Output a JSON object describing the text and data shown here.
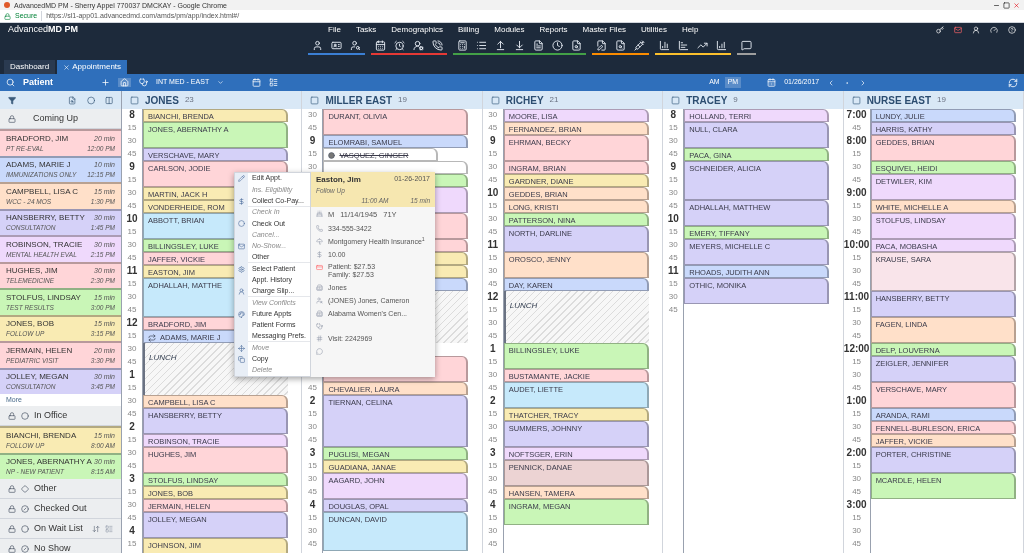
{
  "browser": {
    "title": "AdvancedMD PM - Sherry Appel 770037 DMCKAY - Google Chrome",
    "secure": "Secure",
    "url": "https://sl1-app01.advancedmd.com/amds/pm/app/index.html#/"
  },
  "app": {
    "logo": "Advanced**MD PM**",
    "menu": [
      "File",
      "Tasks",
      "Demographics",
      "Billing",
      "Modules",
      "Reports",
      "Master Files",
      "Utilities",
      "Help"
    ],
    "toolbar_groups": [
      {
        "color": "#3b7fd4"
      },
      {
        "color": "#e53935"
      },
      {
        "color": "#43a047"
      },
      {
        "color": "#fb8c00"
      },
      {
        "color": "#fbc02d"
      },
      {
        "color": "#9e9e9e"
      }
    ]
  },
  "tabs": [
    {
      "label": "Dashboard",
      "selected": false,
      "closable": false
    },
    {
      "label": "Appointments",
      "selected": true,
      "closable": true
    }
  ],
  "patient_bar": {
    "label": "Patient",
    "provider_group": "INT MED - EAST",
    "ampm": [
      {
        "label": "AM",
        "selected": false
      },
      {
        "label": "PM",
        "selected": true
      }
    ],
    "date": "01/26/2017"
  },
  "sidebar": {
    "sections": [
      {
        "title": "Coming Up",
        "more": "More",
        "items": [
          {
            "name": "BRADFORD, JIM",
            "duration": "20 min",
            "reason": "PT RE-EVAL",
            "time": "12:00 PM",
            "color": "#ffd5d8"
          },
          {
            "name": "ADAMS, MARIE J",
            "duration": "10 min",
            "reason": "IMMUNIZATIONS ONLY",
            "time": "12:15 PM",
            "color": "#c9d9fb"
          },
          {
            "name": "CAMPBELL, LISA C",
            "duration": "15 min",
            "reason": "WCC - 24 MOS",
            "time": "1:30 PM",
            "color": "#ffe0c9"
          },
          {
            "name": "HANSBERRY, BETTY",
            "duration": "30 min",
            "reason": "CONSULTATION",
            "time": "1:45 PM",
            "color": "#d5d1f8"
          },
          {
            "name": "ROBINSON, TRACIE",
            "duration": "30 min",
            "reason": "MENTAL HEALTH EVAL",
            "time": "2:15 PM",
            "color": "#efd9fc"
          },
          {
            "name": "HUGHES, JIM",
            "duration": "30 min",
            "reason": "TELEMEDICINE",
            "time": "2:30 PM",
            "color": "#ffd5d8"
          },
          {
            "name": "STOLFUS, LINDSAY",
            "duration": "15 min",
            "reason": "TEST RESULTS",
            "time": "3:00 PM",
            "color": "#c9f6b7"
          },
          {
            "name": "JONES, BOB",
            "duration": "15 min",
            "reason": "FOLLOW UP",
            "time": "3:15 PM",
            "color": "#f9ebb3"
          },
          {
            "name": "JERMAIN, HELEN",
            "duration": "20 min",
            "reason": "PEDIATRIC VISIT",
            "time": "3:30 PM",
            "color": "#ffd5d8"
          },
          {
            "name": "JOLLEY, MEGAN",
            "duration": "30 min",
            "reason": "CONSULTATION",
            "time": "3:45 PM",
            "color": "#d5d1f8"
          }
        ]
      },
      {
        "title": "In Office",
        "items": [
          {
            "name": "BIANCHI, BRENDA",
            "duration": "15 min",
            "reason": "FOLLOW UP",
            "time": "8:00 AM",
            "color": "#f9ebb3"
          },
          {
            "name": "JONES, ABERNATHY A",
            "duration": "30 min",
            "reason": "NP - NEW PATIENT",
            "time": "8:15 AM",
            "color": "#c9f6b7"
          }
        ]
      },
      {
        "title": "Other"
      },
      {
        "title": "Checked Out"
      },
      {
        "title": "On Wait List"
      },
      {
        "title": "No Show"
      }
    ]
  },
  "columns": [
    {
      "name": "JONES",
      "count": "23",
      "ticks": [
        {
          "kind": "hour",
          "t": "8"
        },
        {
          "kind": "minute",
          "t": "15"
        },
        {
          "kind": "minute",
          "t": "30"
        },
        {
          "kind": "minute",
          "t": "45"
        },
        {
          "kind": "hour",
          "t": "9"
        },
        {
          "kind": "minute",
          "t": "15"
        },
        {
          "kind": "minute",
          "t": "30"
        },
        {
          "kind": "minute",
          "t": "45"
        },
        {
          "kind": "hour",
          "t": "10"
        },
        {
          "kind": "minute",
          "t": "15"
        },
        {
          "kind": "minute",
          "t": "30"
        },
        {
          "kind": "minute",
          "t": "45"
        },
        {
          "kind": "hour",
          "t": "11"
        },
        {
          "kind": "minute",
          "t": "15"
        },
        {
          "kind": "minute",
          "t": "30"
        },
        {
          "kind": "minute",
          "t": "45"
        },
        {
          "kind": "hour",
          "t": "12"
        },
        {
          "kind": "minute",
          "t": "15"
        },
        {
          "kind": "minute",
          "t": "30"
        },
        {
          "kind": "minute",
          "t": "45"
        },
        {
          "kind": "hour",
          "t": "1"
        },
        {
          "kind": "minute",
          "t": "15"
        },
        {
          "kind": "minute",
          "t": "30"
        },
        {
          "kind": "minute",
          "t": "45"
        },
        {
          "kind": "hour",
          "t": "2"
        },
        {
          "kind": "minute",
          "t": "15"
        },
        {
          "kind": "minute",
          "t": "30"
        },
        {
          "kind": "minute",
          "t": "45"
        },
        {
          "kind": "hour",
          "t": "3"
        },
        {
          "kind": "minute",
          "t": "15"
        },
        {
          "kind": "minute",
          "t": "30"
        },
        {
          "kind": "minute",
          "t": "45"
        },
        {
          "kind": "hour",
          "t": "4"
        },
        {
          "kind": "minute",
          "t": "15"
        }
      ],
      "appointments": [
        {
          "kind": "appt-15",
          "name": "BIANCHI, BRENDA",
          "color": "#f9ebb3",
          "cancelled": false,
          "recurring": false
        },
        {
          "kind": "appt-30",
          "name": "JONES, ABERNATHY A",
          "color": "#c9f6b7",
          "cancelled": false,
          "recurring": false
        },
        {
          "kind": "appt-15",
          "name": "VERSCHAVE, MARY",
          "color": "#d5d1f8",
          "cancelled": false,
          "recurring": false
        },
        {
          "kind": "appt-30",
          "name": "CARLSON, JODIE",
          "color": "#ffd5d8",
          "cancelled": false,
          "recurring": false
        },
        {
          "kind": "appt-15",
          "name": "MARTIN, JACK H",
          "color": "#f9ebb3",
          "cancelled": false,
          "recurring": false
        },
        {
          "kind": "appt-15",
          "name": "VONDERHEIDE, ROM",
          "color": "#f9ebb3",
          "cancelled": false,
          "recurring": false
        },
        {
          "kind": "appt-30",
          "name": "ABBOTT, BRIAN",
          "color": "#c6e9fb",
          "cancelled": false,
          "recurring": false
        },
        {
          "kind": "appt-15",
          "name": "BILLINGSLEY, LUKE",
          "color": "#c9f6b7",
          "cancelled": false,
          "recurring": false
        },
        {
          "kind": "appt-15",
          "name": "JAFFER, VICKIE",
          "color": "#ffd5d8",
          "cancelled": false,
          "recurring": false
        },
        {
          "kind": "appt-15",
          "name": "EASTON, JIM",
          "color": "#f9ebb3",
          "cancelled": false,
          "recurring": false
        },
        {
          "kind": "appt-45",
          "name": "ADHALLAH, MATTHE",
          "color": "#c6e9fb",
          "cancelled": false,
          "recurring": false
        },
        {
          "kind": "appt-15",
          "name": "BRADFORD, JIM",
          "color": "#ffd5d8",
          "cancelled": false,
          "recurring": false
        },
        {
          "kind": "appt-15",
          "name": "ADAMS, MARIE J",
          "color": "#c9d9fb",
          "cancelled": false,
          "recurring": true
        },
        {
          "kind": "lunch-60",
          "name": "LUNCH"
        },
        {
          "kind": "appt-15",
          "name": "CAMPBELL, LISA C",
          "color": "#ffe0c9",
          "cancelled": false,
          "recurring": false
        },
        {
          "kind": "appt-30",
          "name": "HANSBERRY, BETTY",
          "color": "#d5d1f8",
          "cancelled": false,
          "recurring": false
        },
        {
          "kind": "appt-15",
          "name": "ROBINSON, TRACIE",
          "color": "#efd9fc",
          "cancelled": false,
          "recurring": false
        },
        {
          "kind": "appt-30",
          "name": "HUGHES, JIM",
          "color": "#ffd5d8",
          "cancelled": false,
          "recurring": false
        },
        {
          "kind": "appt-15",
          "name": "STOLFUS, LINDSAY",
          "color": "#c9f6b7",
          "cancelled": false,
          "recurring": false
        },
        {
          "kind": "appt-15",
          "name": "JONES, BOB",
          "color": "#f9ebb3",
          "cancelled": false,
          "recurring": false
        },
        {
          "kind": "appt-15",
          "name": "JERMAIN, HELEN",
          "color": "#ffd5d8",
          "cancelled": false,
          "recurring": false
        },
        {
          "kind": "appt-30",
          "name": "JOLLEY, MEGAN",
          "color": "#d5d1f8",
          "cancelled": false,
          "recurring": false
        },
        {
          "kind": "appt-30",
          "name": "JOHNSON, JIM",
          "color": "#f9ebb3",
          "cancelled": false,
          "recurring": false
        }
      ]
    },
    {
      "name": "MILLER EAST",
      "count": "19",
      "ticks": [
        {
          "kind": "minute",
          "t": "30"
        },
        {
          "kind": "minute",
          "t": "45"
        },
        {
          "kind": "hour",
          "t": "9"
        },
        {
          "kind": "minute",
          "t": "15"
        },
        {
          "kind": "minute",
          "t": "30"
        },
        {
          "kind": "hidden"
        },
        {
          "kind": "hidden"
        },
        {
          "kind": "hidden"
        },
        {
          "kind": "hidden"
        },
        {
          "kind": "hidden"
        },
        {
          "kind": "hidden"
        },
        {
          "kind": "hidden"
        },
        {
          "kind": "hidden"
        },
        {
          "kind": "hidden"
        },
        {
          "kind": "hidden"
        },
        {
          "kind": "hidden"
        },
        {
          "kind": "hidden"
        },
        {
          "kind": "hidden"
        },
        {
          "kind": "hidden"
        },
        {
          "kind": "hidden"
        },
        {
          "kind": "hidden"
        },
        {
          "kind": "minute",
          "t": "45"
        },
        {
          "kind": "hour",
          "t": "2"
        },
        {
          "kind": "minute",
          "t": "15"
        },
        {
          "kind": "minute",
          "t": "30"
        },
        {
          "kind": "minute",
          "t": "45"
        },
        {
          "kind": "hour",
          "t": "3"
        },
        {
          "kind": "minute",
          "t": "15"
        },
        {
          "kind": "minute",
          "t": "30"
        },
        {
          "kind": "minute",
          "t": "45"
        },
        {
          "kind": "hour",
          "t": "4"
        },
        {
          "kind": "minute",
          "t": "15"
        },
        {
          "kind": "minute",
          "t": "30"
        },
        {
          "kind": "minute",
          "t": "45"
        }
      ],
      "appointments": [
        {
          "kind": "appt-30",
          "name": "DURANT, OLIVIA",
          "color": "#ffd5d8",
          "cancelled": false,
          "recurring": false
        },
        {
          "kind": "appt-15",
          "name": "ELOMRABI, SAMUEL",
          "color": "#c9d9fb",
          "cancelled": false,
          "recurring": false
        },
        {
          "kind": "appt-15",
          "name": "VASQUEZ, GINGER",
          "color": "#ffffff",
          "cancelled": true,
          "recurring": false
        },
        {
          "kind": "appt-15",
          "color": "#ffffff"
        },
        {
          "kind": "appt-15",
          "color": "#c9f6b7"
        },
        {
          "kind": "appt-30",
          "color": "#efd9fc"
        },
        {
          "kind": "appt-30",
          "color": "#ffd5d8"
        },
        {
          "kind": "appt-15",
          "color": "#ffd5d8"
        },
        {
          "kind": "appt-15",
          "color": "#f9ebb3"
        },
        {
          "kind": "appt-15",
          "color": "#f9ebb3"
        },
        {
          "kind": "appt-15",
          "color": "#c9d9fb"
        },
        {
          "kind": "lunch-60"
        },
        {
          "kind": "gap-15"
        },
        {
          "kind": "appt-30",
          "color": "#ffd5d8"
        },
        {
          "kind": "appt-15",
          "name": "CHEVALIER, LAURA",
          "color": "#ffe0c9",
          "cancelled": false,
          "recurring": false
        },
        {
          "kind": "appt-60",
          "name": "TIERNAN, CELINA",
          "color": "#d5d1f8",
          "cancelled": false,
          "recurring": false
        },
        {
          "kind": "appt-15",
          "name": "PUGLISI, MEGAN",
          "color": "#c9f6b7",
          "cancelled": false,
          "recurring": false
        },
        {
          "kind": "appt-15",
          "name": "GUADIANA, JANAE",
          "color": "#f9ebb3",
          "cancelled": false,
          "recurring": false
        },
        {
          "kind": "appt-30",
          "name": "AAGARD, JOHN",
          "color": "#efd9fc",
          "cancelled": false,
          "recurring": false
        },
        {
          "kind": "appt-15",
          "name": "DOUGLAS, OPAL",
          "color": "#d5d1f8",
          "cancelled": false,
          "recurring": false
        },
        {
          "kind": "appt-45",
          "name": "DUNCAN, DAVID",
          "color": "#c6e9fb",
          "cancelled": false,
          "recurring": false
        }
      ]
    },
    {
      "name": "RICHEY",
      "count": "21",
      "ticks": [
        {
          "kind": "minute",
          "t": "30"
        },
        {
          "kind": "minute",
          "t": "45"
        },
        {
          "kind": "hour",
          "t": "9"
        },
        {
          "kind": "minute",
          "t": "15"
        },
        {
          "kind": "minute",
          "t": "30"
        },
        {
          "kind": "minute",
          "t": "45"
        },
        {
          "kind": "hour",
          "t": "10"
        },
        {
          "kind": "minute",
          "t": "15"
        },
        {
          "kind": "minute",
          "t": "30"
        },
        {
          "kind": "minute",
          "t": "45"
        },
        {
          "kind": "hour",
          "t": "11"
        },
        {
          "kind": "minute",
          "t": "15"
        },
        {
          "kind": "minute",
          "t": "30"
        },
        {
          "kind": "minute",
          "t": "45"
        },
        {
          "kind": "hour",
          "t": "12"
        },
        {
          "kind": "minute",
          "t": "15"
        },
        {
          "kind": "minute",
          "t": "30"
        },
        {
          "kind": "minute",
          "t": "45"
        },
        {
          "kind": "hour",
          "t": "1"
        },
        {
          "kind": "minute",
          "t": "15"
        },
        {
          "kind": "minute",
          "t": "30"
        },
        {
          "kind": "minute",
          "t": "45"
        },
        {
          "kind": "hour",
          "t": "2"
        },
        {
          "kind": "minute",
          "t": "15"
        },
        {
          "kind": "minute",
          "t": "30"
        },
        {
          "kind": "minute",
          "t": "45"
        },
        {
          "kind": "hour",
          "t": "3"
        },
        {
          "kind": "minute",
          "t": "15"
        },
        {
          "kind": "minute",
          "t": "30"
        },
        {
          "kind": "minute",
          "t": "45"
        },
        {
          "kind": "hour",
          "t": "4"
        },
        {
          "kind": "minute",
          "t": "15"
        },
        {
          "kind": "minute",
          "t": "30"
        },
        {
          "kind": "minute",
          "t": "45"
        }
      ],
      "appointments": [
        {
          "kind": "appt-15",
          "name": "MOORE, LISA",
          "color": "#efd9fc",
          "cancelled": false,
          "recurring": false
        },
        {
          "kind": "appt-15",
          "name": "FERNANDEZ, BRIAN",
          "color": "#ffe0c9",
          "cancelled": false,
          "recurring": false
        },
        {
          "kind": "appt-30",
          "name": "EHRMAN, BECKY",
          "color": "#ffd5d8",
          "cancelled": false,
          "recurring": false
        },
        {
          "kind": "appt-15",
          "name": "INGRAM, BRIAN",
          "color": "#ffd5d8",
          "cancelled": false,
          "recurring": false
        },
        {
          "kind": "appt-15",
          "name": "GARDNER, DIANE",
          "color": "#f9ebb3",
          "cancelled": false,
          "recurring": false
        },
        {
          "kind": "appt-15",
          "name": "GEDDES, BRIAN",
          "color": "#ffe0c9",
          "cancelled": false,
          "recurring": false
        },
        {
          "kind": "appt-15",
          "name": "LONG, KRISTI",
          "color": "#ffe0c9",
          "cancelled": false,
          "recurring": false
        },
        {
          "kind": "appt-15",
          "name": "PATTERSON, NINA",
          "color": "#c9f6b7",
          "cancelled": false,
          "recurring": false
        },
        {
          "kind": "appt-30",
          "name": "NORTH, DARLINE",
          "color": "#d5d1f8",
          "cancelled": false,
          "recurring": false
        },
        {
          "kind": "appt-30",
          "name": "OROSCO, JENNY",
          "color": "#ffe0c9",
          "cancelled": false,
          "recurring": false
        },
        {
          "kind": "appt-15",
          "name": "DAY, KAREN",
          "color": "#c9d9fb",
          "cancelled": false,
          "recurring": false
        },
        {
          "kind": "lunch-60",
          "name": "LUNCH"
        },
        {
          "kind": "appt-30",
          "name": "BILLINGSLEY, LUKE",
          "color": "#c9f6b7",
          "cancelled": false,
          "recurring": false
        },
        {
          "kind": "appt-15",
          "name": "BUSTAMANTE, JACKIE",
          "color": "#ffd5d8",
          "cancelled": false,
          "recurring": false
        },
        {
          "kind": "appt-30",
          "name": "AUDET, LIETTE",
          "color": "#c6e9fb",
          "cancelled": false,
          "recurring": false
        },
        {
          "kind": "appt-15",
          "name": "THATCHER, TRACY",
          "color": "#f9ebb3",
          "cancelled": false,
          "recurring": false
        },
        {
          "kind": "appt-30",
          "name": "SUMMERS, JOHNNY",
          "color": "#d5d1f8",
          "cancelled": false,
          "recurring": false
        },
        {
          "kind": "appt-15",
          "name": "NOFTSGER, ERIN",
          "color": "#efd9fc",
          "cancelled": false,
          "recurring": false
        },
        {
          "kind": "appt-30",
          "name": "PENNICK, DANAE",
          "color": "#ecd3d3",
          "cancelled": false,
          "recurring": false
        },
        {
          "kind": "appt-15",
          "name": "HANSEN, TAMERA",
          "color": "#ffe0c9",
          "cancelled": false,
          "recurring": false
        },
        {
          "kind": "appt-30",
          "name": "INGRAM, MEGAN",
          "color": "#c9f6b7",
          "cancelled": false,
          "recurring": false
        }
      ]
    },
    {
      "name": "TRACEY",
      "count": "9",
      "ticks": [
        {
          "kind": "hour",
          "t": "8"
        },
        {
          "kind": "minute",
          "t": "15"
        },
        {
          "kind": "minute",
          "t": "30"
        },
        {
          "kind": "minute",
          "t": "45"
        },
        {
          "kind": "hour",
          "t": "9"
        },
        {
          "kind": "minute",
          "t": "15"
        },
        {
          "kind": "minute",
          "t": "30"
        },
        {
          "kind": "minute",
          "t": "45"
        },
        {
          "kind": "hour",
          "t": "10"
        },
        {
          "kind": "minute",
          "t": "15"
        },
        {
          "kind": "minute",
          "t": "30"
        },
        {
          "kind": "minute",
          "t": "45"
        },
        {
          "kind": "hour",
          "t": "11"
        },
        {
          "kind": "minute",
          "t": "15"
        },
        {
          "kind": "minute",
          "t": "30"
        },
        {
          "kind": "minute",
          "t": "45"
        }
      ],
      "appointments": [
        {
          "kind": "appt-15",
          "name": "HOLLAND, TERRI",
          "color": "#efd9fc",
          "cancelled": false,
          "recurring": false
        },
        {
          "kind": "appt-30",
          "name": "NULL, CLARA",
          "color": "#d5d1f8",
          "cancelled": false,
          "recurring": false
        },
        {
          "kind": "appt-15",
          "name": "PACA, GINA",
          "color": "#c9f6b7",
          "cancelled": false,
          "recurring": false
        },
        {
          "kind": "appt-45",
          "name": "SCHNEIDER, ALICIA",
          "color": "#d5d1f8",
          "cancelled": false,
          "recurring": false
        },
        {
          "kind": "appt-30",
          "name": "ADHALLAH, MATTHEW",
          "color": "#d5d1f8",
          "cancelled": false,
          "recurring": false
        },
        {
          "kind": "appt-15",
          "name": "EMERY, TIFFANY",
          "color": "#c9f6b7",
          "cancelled": false,
          "recurring": false
        },
        {
          "kind": "appt-30",
          "name": "MEYERS, MICHELLE C",
          "color": "#d5d1f8",
          "cancelled": false,
          "recurring": false
        },
        {
          "kind": "appt-15",
          "name": "RHOADS, JUDITH ANN",
          "color": "#c9d9fb",
          "cancelled": false,
          "recurring": false
        },
        {
          "kind": "appt-30",
          "name": "OTHIC, MONIKA",
          "color": "#d5d1f8",
          "cancelled": false,
          "recurring": false
        }
      ]
    },
    {
      "name": "NURSE EAST",
      "count": "19",
      "ticks": [
        {
          "kind": "hour",
          "t": "7:00"
        },
        {
          "kind": "minute",
          "t": "45"
        },
        {
          "kind": "hour",
          "t": "8:00"
        },
        {
          "kind": "minute",
          "t": "15"
        },
        {
          "kind": "minute",
          "t": "30"
        },
        {
          "kind": "minute",
          "t": "45"
        },
        {
          "kind": "hour",
          "t": "9:00"
        },
        {
          "kind": "minute",
          "t": "15"
        },
        {
          "kind": "minute",
          "t": "30"
        },
        {
          "kind": "minute",
          "t": "45"
        },
        {
          "kind": "hour",
          "t": "10:00"
        },
        {
          "kind": "minute",
          "t": "15"
        },
        {
          "kind": "minute",
          "t": "30"
        },
        {
          "kind": "minute",
          "t": "45"
        },
        {
          "kind": "hour",
          "t": "11:00"
        },
        {
          "kind": "minute",
          "t": "15"
        },
        {
          "kind": "minute",
          "t": "30"
        },
        {
          "kind": "minute",
          "t": "45"
        },
        {
          "kind": "hour",
          "t": "12:00"
        },
        {
          "kind": "minute",
          "t": "15"
        },
        {
          "kind": "minute",
          "t": "30"
        },
        {
          "kind": "minute",
          "t": "45"
        },
        {
          "kind": "hour",
          "t": "1:00"
        },
        {
          "kind": "minute",
          "t": "15"
        },
        {
          "kind": "minute",
          "t": "30"
        },
        {
          "kind": "minute",
          "t": "45"
        },
        {
          "kind": "hour",
          "t": "2:00"
        },
        {
          "kind": "minute",
          "t": "15"
        },
        {
          "kind": "minute",
          "t": "30"
        },
        {
          "kind": "minute",
          "t": "45"
        },
        {
          "kind": "hour",
          "t": "3:00"
        },
        {
          "kind": "minute",
          "t": "15"
        },
        {
          "kind": "minute",
          "t": "30"
        },
        {
          "kind": "minute",
          "t": "45"
        }
      ],
      "appointments": [
        {
          "kind": "appt-15",
          "name": "LUNDY, JULIE",
          "color": "#c9d9fb",
          "cancelled": false,
          "recurring": false
        },
        {
          "kind": "appt-15",
          "name": "HARRIS, KATHY",
          "color": "#d5d1f8",
          "cancelled": false,
          "recurring": false
        },
        {
          "kind": "appt-30",
          "name": "GEDDES, BRIAN",
          "color": "#ffd5d8",
          "cancelled": false,
          "recurring": false
        },
        {
          "kind": "appt-15",
          "name": "ESQUIVEL, HEIDI",
          "color": "#c9f6b7",
          "cancelled": false,
          "recurring": false
        },
        {
          "kind": "appt-30",
          "name": "DETWILER, KIM",
          "color": "#efd9fc",
          "cancelled": false,
          "recurring": false
        },
        {
          "kind": "appt-15",
          "name": "WHITE, MICHELLE A",
          "color": "#ffe0c9",
          "cancelled": false,
          "recurring": false
        },
        {
          "kind": "appt-30",
          "name": "STOLFUS, LINDSAY",
          "color": "#efd9fc",
          "cancelled": false,
          "recurring": false
        },
        {
          "kind": "appt-15",
          "name": "PACA, MOBASHA",
          "color": "#efd9fc",
          "cancelled": false,
          "recurring": false
        },
        {
          "kind": "appt-45",
          "name": "KRAUSE, SARA",
          "color": "#f9e4ea",
          "cancelled": false,
          "recurring": false
        },
        {
          "kind": "appt-30",
          "name": "HANSBERRY, BETTY",
          "color": "#d5d1f8",
          "cancelled": false,
          "recurring": false
        },
        {
          "kind": "appt-30",
          "name": "FAGEN, LINDA",
          "color": "#ffe0c9",
          "cancelled": false,
          "recurring": false
        },
        {
          "kind": "appt-15",
          "name": "DELP, LOUVERNA",
          "color": "#c9f6b7",
          "cancelled": false,
          "recurring": false
        },
        {
          "kind": "appt-30",
          "name": "ZEIGLER, JENNIFER",
          "color": "#d5d1f8",
          "cancelled": false,
          "recurring": false
        },
        {
          "kind": "appt-30",
          "name": "VERSCHAVE, MARY",
          "color": "#ffd5d8",
          "cancelled": false,
          "recurring": false
        },
        {
          "kind": "appt-15",
          "name": "ARANDA, RAMI",
          "color": "#c9d9fb",
          "cancelled": false,
          "recurring": false
        },
        {
          "kind": "appt-15",
          "name": "FENNELL-BURLESON, ERICA",
          "color": "#ffd5d8",
          "cancelled": false,
          "recurring": false
        },
        {
          "kind": "appt-15",
          "name": "JAFFER, VICKIE",
          "color": "#ffe0c9",
          "cancelled": false,
          "recurring": false
        },
        {
          "kind": "appt-30",
          "name": "PORTER, CHRISTINE",
          "color": "#d5d1f8",
          "cancelled": false,
          "recurring": false
        },
        {
          "kind": "appt-30",
          "name": "MCARDLE, HELEN",
          "color": "#c9f6b7",
          "cancelled": false,
          "recurring": false
        }
      ]
    }
  ],
  "context_menu": [
    {
      "label": "Edit Appt.",
      "disabled": false,
      "divider": false
    },
    {
      "label": "Ins. Eligibility",
      "disabled": true,
      "divider": false
    },
    {
      "label": "Collect Co-Pay...",
      "disabled": false,
      "divider": true
    },
    {
      "label": "Check In",
      "disabled": true,
      "divider": false
    },
    {
      "label": "Check Out",
      "disabled": false,
      "divider": false
    },
    {
      "label": "Cancel...",
      "disabled": true,
      "divider": false
    },
    {
      "label": "No-Show...",
      "disabled": true,
      "divider": false
    },
    {
      "label": "Other",
      "disabled": false,
      "divider": true
    },
    {
      "label": "Select Patient",
      "disabled": false,
      "divider": false
    },
    {
      "label": "Appt. History",
      "disabled": false,
      "divider": false
    },
    {
      "label": "Charge Slip...",
      "disabled": false,
      "divider": true
    },
    {
      "label": "View Conflicts",
      "disabled": true,
      "divider": false
    },
    {
      "label": "Future Appts",
      "disabled": false,
      "divider": false
    },
    {
      "label": "Patient Forms",
      "disabled": false,
      "divider": false
    },
    {
      "label": "Messaging Prefs.",
      "disabled": false,
      "divider": true
    },
    {
      "label": "Move",
      "disabled": true,
      "divider": false
    },
    {
      "label": "Copy",
      "disabled": false,
      "divider": false
    },
    {
      "label": "Delete",
      "disabled": true,
      "divider": false
    }
  ],
  "appointment_card": {
    "name": "Easton, Jim",
    "date": "01-26-2017",
    "reason": "Follow Up",
    "time": "11:00 AM",
    "duration": "15 min",
    "rows": [
      {
        "kind": "demographics",
        "sex": "M",
        "dob": "11/14/1945",
        "age": "71Y"
      },
      {
        "kind": "phone",
        "text": "334-555-3422"
      },
      {
        "kind": "insurance",
        "text": "Montgomery Health Insurance$^{1}$"
      },
      {
        "kind": "copay",
        "text": "10.00"
      },
      {
        "kind": "balance",
        "lines": [
          "Patient: $27.53",
          "Family: $27.53"
        ]
      },
      {
        "kind": "provider",
        "text": "Jones"
      },
      {
        "kind": "referring",
        "text": "(JONES) Jones, Cameron"
      },
      {
        "kind": "facility",
        "text": "Alabama Women's Cen..."
      },
      {
        "kind": "stethoscope"
      },
      {
        "kind": "visit",
        "text": "Visit: 2242969"
      },
      {
        "kind": "comment"
      }
    ]
  }
}
